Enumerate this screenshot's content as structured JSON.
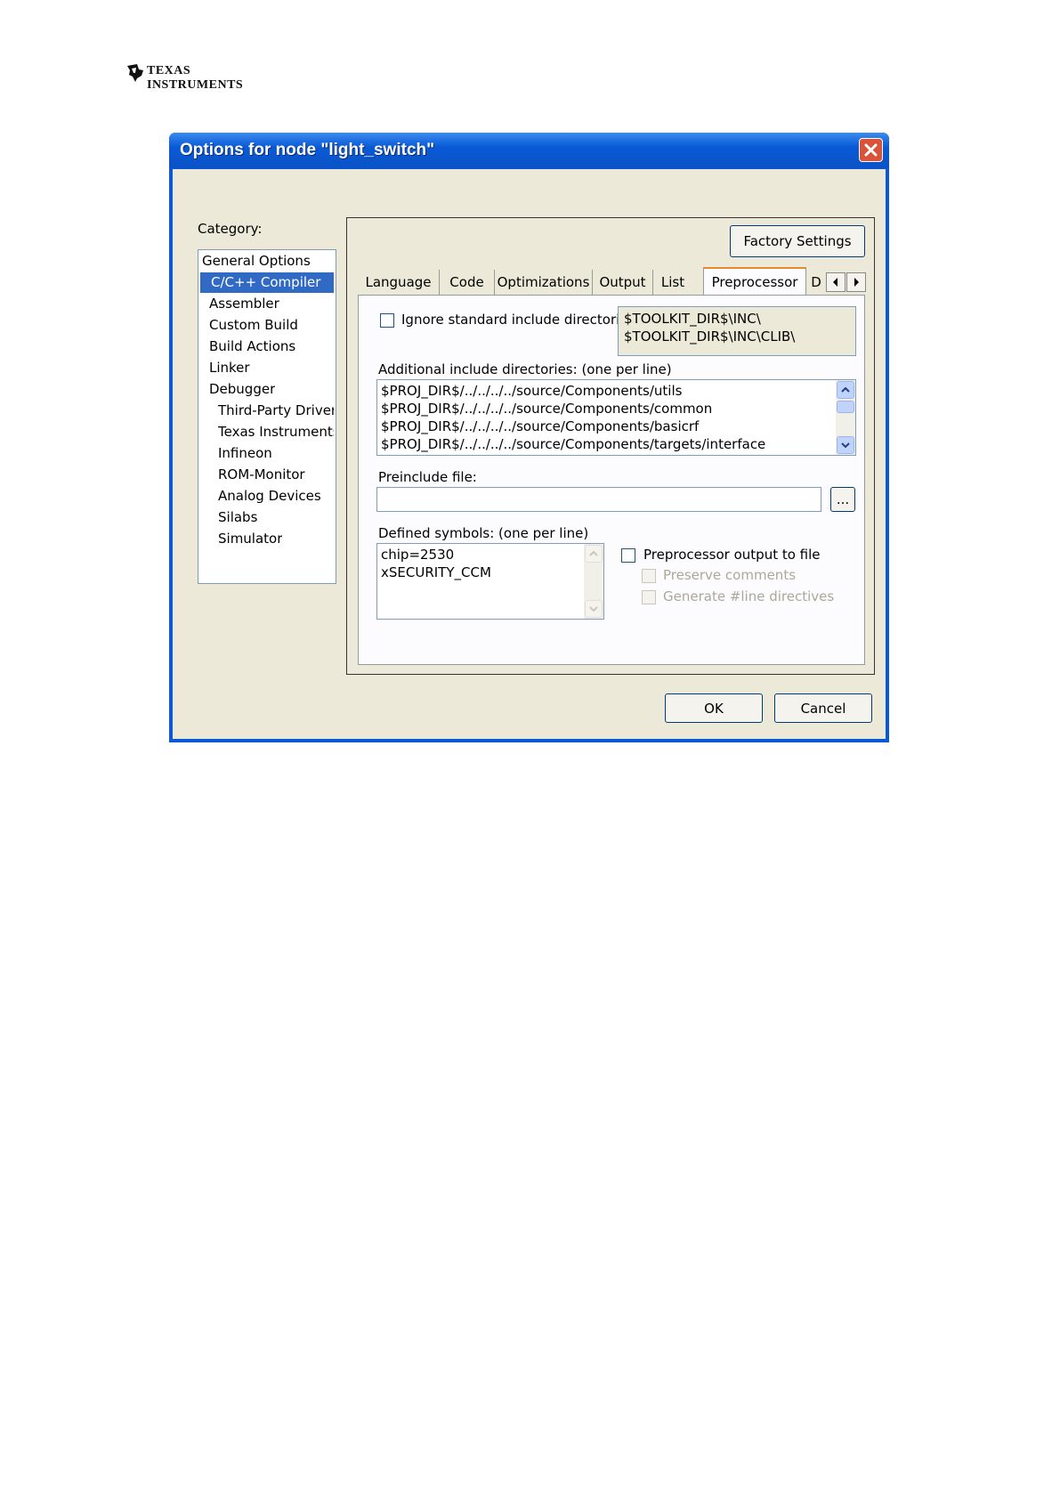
{
  "logo": {
    "line1": "TEXAS",
    "line2": "INSTRUMENTS"
  },
  "window": {
    "title": "Options for node \"light_switch\""
  },
  "category": {
    "label": "Category:",
    "items": [
      {
        "label": "General Options"
      },
      {
        "label": "C/C++ Compiler",
        "selected": true
      },
      {
        "label": "Assembler"
      },
      {
        "label": "Custom Build"
      },
      {
        "label": "Build Actions"
      },
      {
        "label": "Linker"
      },
      {
        "label": "Debugger"
      },
      {
        "label": "Third-Party Driver"
      },
      {
        "label": "Texas Instruments"
      },
      {
        "label": "Infineon"
      },
      {
        "label": "ROM-Monitor"
      },
      {
        "label": "Analog Devices"
      },
      {
        "label": "Silabs"
      },
      {
        "label": "Simulator"
      }
    ]
  },
  "factory_settings_label": "Factory Settings",
  "tabs": [
    {
      "label": "Language"
    },
    {
      "label": "Code"
    },
    {
      "label": "Optimizations"
    },
    {
      "label": "Output"
    },
    {
      "label": "List"
    },
    {
      "label": "Preprocessor",
      "active": true
    },
    {
      "label": "D"
    }
  ],
  "preprocessor": {
    "ignore_std_label": "Ignore standard include directories",
    "std_dirs": [
      "$TOOLKIT_DIR$\\INC\\",
      "$TOOLKIT_DIR$\\INC\\CLIB\\"
    ],
    "additional_label": "Additional include directories: (one per line)",
    "additional_dirs": [
      "$PROJ_DIR$/../../../../source/Components/utils",
      "$PROJ_DIR$/../../../../source/Components/common",
      "$PROJ_DIR$/../../../../source/Components/basicrf",
      "$PROJ_DIR$/../../../../source/Components/targets/interface"
    ],
    "preinclude_label": "Preinclude file:",
    "preinclude_value": "",
    "browse_label": "...",
    "defined_label": "Defined symbols: (one per line)",
    "defined_symbols": [
      "chip=2530",
      "xSECURITY_CCM"
    ],
    "output_to_file_label": "Preprocessor output to file",
    "preserve_comments_label": "Preserve comments",
    "generate_line_label": "Generate #line directives"
  },
  "buttons": {
    "ok": "OK",
    "cancel": "Cancel"
  }
}
